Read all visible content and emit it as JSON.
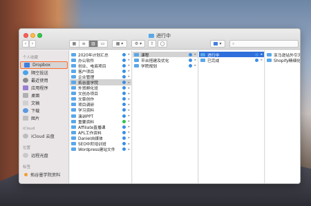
{
  "window": {
    "title": "进行中"
  },
  "toolbar": {
    "back": "‹",
    "forward": "›",
    "views": [
      "▦",
      "≡",
      "▥",
      "▭"
    ],
    "arrange": "▦ ▾",
    "action": "⚙ ▾",
    "share": "⇪",
    "tag": "◯",
    "dropbox": "▾",
    "search_placeholder": ""
  },
  "sidebar": {
    "sections": [
      {
        "header": "个人收藏",
        "items": [
          {
            "label": "Dropbox",
            "icon": "dropbox-icon"
          },
          {
            "label": "隔空投送",
            "icon": "airdrop-icon"
          },
          {
            "label": "最近使用",
            "icon": "recents-icon"
          },
          {
            "label": "应用程序",
            "icon": "applications-icon"
          },
          {
            "label": "桌面",
            "icon": "desktop-icon"
          },
          {
            "label": "文稿",
            "icon": "documents-icon"
          },
          {
            "label": "下载",
            "icon": "downloads-icon"
          },
          {
            "label": "图片",
            "icon": "pictures-icon"
          }
        ]
      },
      {
        "header": "iCloud",
        "items": [
          {
            "label": "iCloud 云盘",
            "icon": "icloud-icon"
          }
        ]
      },
      {
        "header": "位置",
        "items": [
          {
            "label": "远程光盘",
            "icon": "remote-disc-icon"
          }
        ]
      },
      {
        "header": "标签",
        "items": [
          {
            "label": "拓谷墨学院资料",
            "icon": "tag-orange-icon"
          }
        ]
      }
    ]
  },
  "columns": {
    "c1": [
      {
        "label": "2020年计划汇总",
        "status": "blue"
      },
      {
        "label": "办公软件",
        "status": "blue"
      },
      {
        "label": "创业、电商项目",
        "status": "blue"
      },
      {
        "label": "客户项目",
        "status": "blue"
      },
      {
        "label": "企业管理",
        "status": "blue"
      },
      {
        "label": "拓谷墨学院",
        "status": "blue",
        "selected": "grey"
      },
      {
        "label": "外贸孵化班",
        "status": "blue"
      },
      {
        "label": "文创办项目",
        "status": "blue"
      },
      {
        "label": "文章创作",
        "status": "blue"
      },
      {
        "label": "项目调研",
        "status": "blue"
      },
      {
        "label": "学习资料",
        "status": "blue"
      },
      {
        "label": "演讲PPT",
        "status": "blue"
      },
      {
        "label": "重要资料",
        "status": "green"
      },
      {
        "label": "Affiliate直播课",
        "status": "blue"
      },
      {
        "label": "APL工作资料",
        "status": "blue"
      },
      {
        "label": "Daniel自媒体",
        "status": "blue"
      },
      {
        "label": "SEO中阶培训班",
        "status": "blue"
      },
      {
        "label": "Wordpress建站文件",
        "status": "blue"
      }
    ],
    "c2": [
      {
        "label": "课程",
        "status": "blue",
        "selected": "grey"
      },
      {
        "label": "平台搭建及优化",
        "status": "blue"
      },
      {
        "label": "学院规划",
        "status": "blue"
      }
    ],
    "c3": [
      {
        "label": "进行中",
        "status": "blue",
        "selected": "blue"
      },
      {
        "label": "已完成",
        "status": "blue"
      }
    ],
    "c4": [
      {
        "label": "亚马逊站外引流"
      },
      {
        "label": "Shopify精细化运营"
      }
    ]
  }
}
